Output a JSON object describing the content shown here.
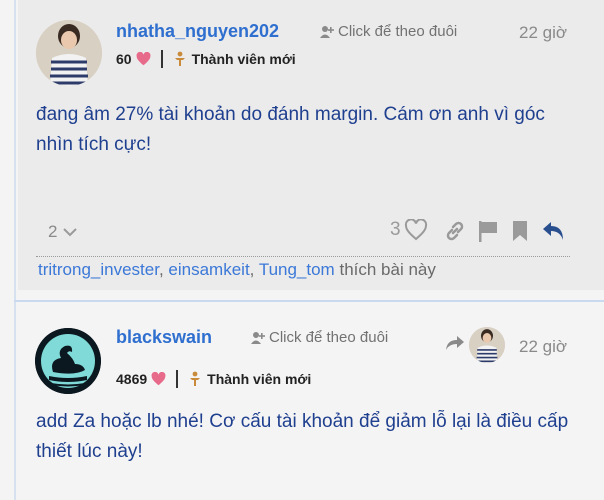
{
  "post1": {
    "username": "nhatha_nguyen202",
    "follow_label": "Click để theo đuôi",
    "time": "22 giờ",
    "likes": "60",
    "rank": "Thành viên mới",
    "text": "đang âm 27% tài khoản do đánh margin. Cám ơn anh vì góc nhìn tích cực!",
    "replies_count": "2",
    "like_count": "3",
    "likers": [
      "tritrong_invester",
      "einsamkeit",
      "Tung_tom"
    ],
    "likers_suffix": "thích bài này",
    "separator": ", "
  },
  "post2": {
    "username": "blackswain",
    "follow_label": "Click để theo đuôi",
    "time": "22 giờ",
    "likes": "4869",
    "rank": "Thành viên mới",
    "text": "add Za hoặc lb nhé! Cơ cấu tài khoản để giảm lỗ lại là điều cấp thiết lúc này!"
  },
  "colors": {
    "accent": "#2f6fcf",
    "body_text": "#1f3f8f",
    "heart": "#e86a8a",
    "badge": "#c98a3a"
  },
  "icons": [
    "follow-user-icon",
    "heart-icon",
    "member-badge-icon",
    "chevron-down-icon",
    "link-icon",
    "flag-icon",
    "bookmark-icon",
    "reply-icon",
    "reply-to-icon"
  ]
}
